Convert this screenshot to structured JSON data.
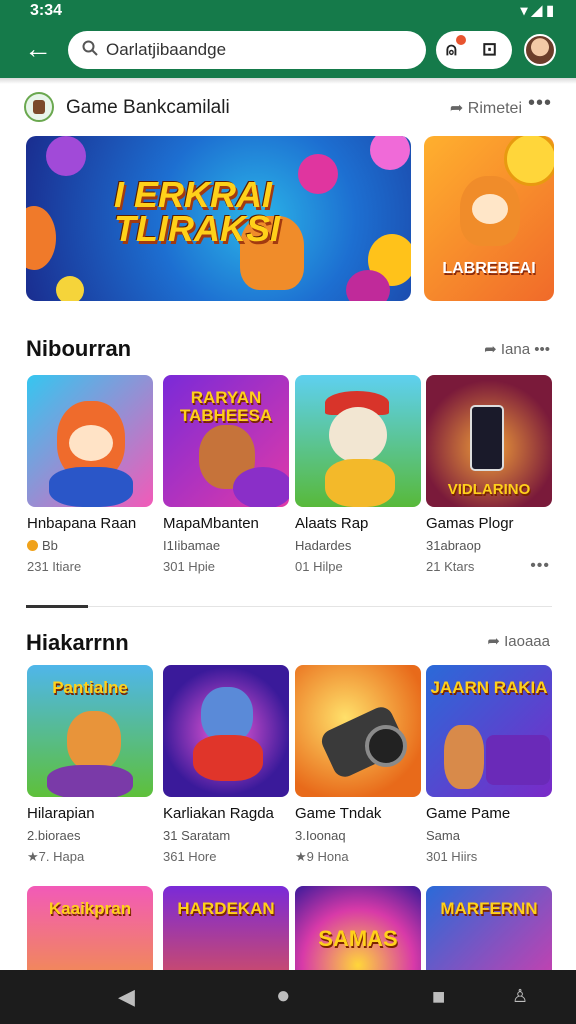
{
  "status": {
    "time": "3:34"
  },
  "search": {
    "value": "Oarlatjibaandge"
  },
  "developer": {
    "name": "Game Bankcamilali",
    "share_label": "Rimetei"
  },
  "banners": [
    {
      "title": "I ERKRAI TLIRAKSI"
    },
    {
      "title": "LABREBEAI"
    }
  ],
  "sections": [
    {
      "title": "Nibourran",
      "more_label": "Iana",
      "cards": [
        {
          "thumb_text": "",
          "name": "Hnbapana Raan",
          "sub": "Bb",
          "meta": "231 Itiare"
        },
        {
          "thumb_text": "RARYAN TABHEESA",
          "name": "MapaMbanten",
          "sub": "I1Iibamae",
          "meta": "301 Hpie"
        },
        {
          "thumb_text": "",
          "name": "Alaats Rap",
          "sub": "Hadardes",
          "meta": "01 Hilpe"
        },
        {
          "thumb_text": "VIDLARINO",
          "name": "Gamas Plogr",
          "sub": "31abraop",
          "meta": "21 Ktars"
        }
      ]
    },
    {
      "title": "Hiakarrnn",
      "more_label": "Iaoaaa",
      "cards": [
        {
          "thumb_text": "Pantialne",
          "name": "Hilarapian",
          "sub": "2.bioraes",
          "meta": "7. Hapa"
        },
        {
          "thumb_text": "",
          "name": "Karliakan Ragda",
          "sub": "31 Saratam",
          "meta": "361 Hore"
        },
        {
          "thumb_text": "",
          "name": "Game Tndak",
          "sub": "3.Ioonaq",
          "meta": "9 Hona"
        },
        {
          "thumb_text": "JAARN RAKIA",
          "name": "Game Pame",
          "sub": "Sama",
          "meta": "301 Hiirs"
        }
      ]
    },
    {
      "title": "",
      "more_label": "",
      "cards": [
        {
          "thumb_text": "Kaaikpran",
          "name": "",
          "sub": "",
          "meta": ""
        },
        {
          "thumb_text": "HARDEKAN",
          "name": "",
          "sub": "",
          "meta": ""
        },
        {
          "thumb_text": "SAMAS",
          "name": "",
          "sub": "",
          "meta": ""
        },
        {
          "thumb_text": "MARFERNN",
          "name": "",
          "sub": "",
          "meta": ""
        }
      ]
    }
  ],
  "colors": {
    "app_bar": "#157a4a",
    "nav_bar": "#1c1c1c",
    "accent_star": "#f0a21b"
  }
}
